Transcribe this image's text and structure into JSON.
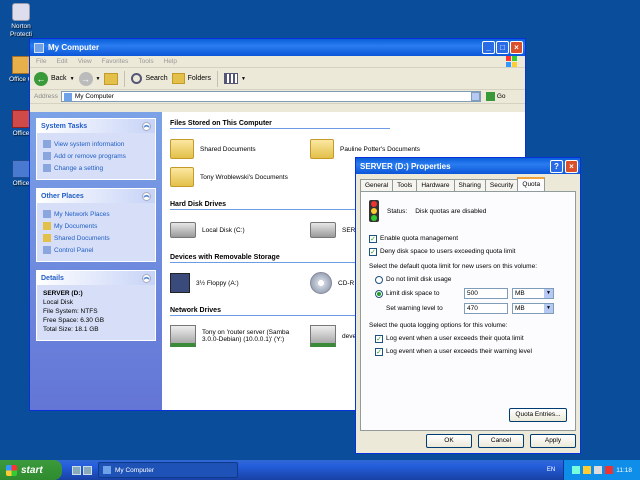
{
  "desktop": {
    "icons": [
      {
        "label": "Norton Protection",
        "label2": "Protecti",
        "name": "Norton"
      },
      {
        "label": "Micro Office O",
        "label2": "Office O"
      },
      {
        "label": "Micro Office",
        "label2": "Office"
      },
      {
        "label": "Micro Office",
        "label2": "Office"
      }
    ]
  },
  "window": {
    "title": "My Computer",
    "menu": [
      "File",
      "Edit",
      "View",
      "Favorites",
      "Tools",
      "Help"
    ],
    "toolbar": {
      "back": "Back",
      "search": "Search",
      "folders": "Folders"
    },
    "address": {
      "label": "Address",
      "value": "My Computer",
      "go": "Go"
    },
    "sidebar": {
      "system_tasks": {
        "title": "System Tasks",
        "items": [
          "View system information",
          "Add or remove programs",
          "Change a setting"
        ]
      },
      "other_places": {
        "title": "Other Places",
        "items": [
          "My Network Places",
          "My Documents",
          "Shared Documents",
          "Control Panel"
        ]
      },
      "details": {
        "title": "Details",
        "name": "SERVER (D:)",
        "type": "Local Disk",
        "fs": "File System: NTFS",
        "free": "Free Space: 6.30 GB",
        "total": "Total Size: 18.1 GB"
      }
    },
    "sections": {
      "files": {
        "title": "Files Stored on This Computer",
        "items": [
          "Shared Documents",
          "Pauline Potter's Documents",
          "Tony Wroblewski's Documents"
        ]
      },
      "hdd": {
        "title": "Hard Disk Drives",
        "items": [
          "Local Disk (C:)",
          "SERV"
        ]
      },
      "removable": {
        "title": "Devices with Removable Storage",
        "items": [
          "3½ Floppy (A:)",
          "CD-R"
        ]
      },
      "network": {
        "title": "Network Drives",
        "items": [
          "Tony on 'router server (Samba 3.0.0-Debian) (10.0.0.1)' (Y:)",
          "deve (Z:)"
        ]
      }
    }
  },
  "dialog": {
    "title": "SERVER (D:) Properties",
    "tabs": [
      "General",
      "Tools",
      "Hardware",
      "Sharing",
      "Security",
      "Quota"
    ],
    "active_tab": "Quota",
    "status_label": "Status:",
    "status_value": "Disk quotas are disabled",
    "enable_quota": "Enable quota management",
    "deny_disk": "Deny disk space to users exceeding quota limit",
    "select_default": "Select the default quota limit for new users on this volume:",
    "no_limit": "Do not limit disk usage",
    "limit_to": "Limit disk space to",
    "limit_value": "500",
    "limit_unit": "MB",
    "warn_label": "Set warning level to",
    "warn_value": "470",
    "warn_unit": "MB",
    "logging_label": "Select the quota logging options for this volume:",
    "log_exceed": "Log event when a user exceeds their quota limit",
    "log_warning": "Log event when a user exceeds their warning level",
    "quota_entries": "Quota Entries...",
    "ok": "OK",
    "cancel": "Cancel",
    "apply": "Apply"
  },
  "taskbar": {
    "start": "start",
    "task": "My Computer",
    "lang": "EN",
    "clock": "11:18"
  }
}
